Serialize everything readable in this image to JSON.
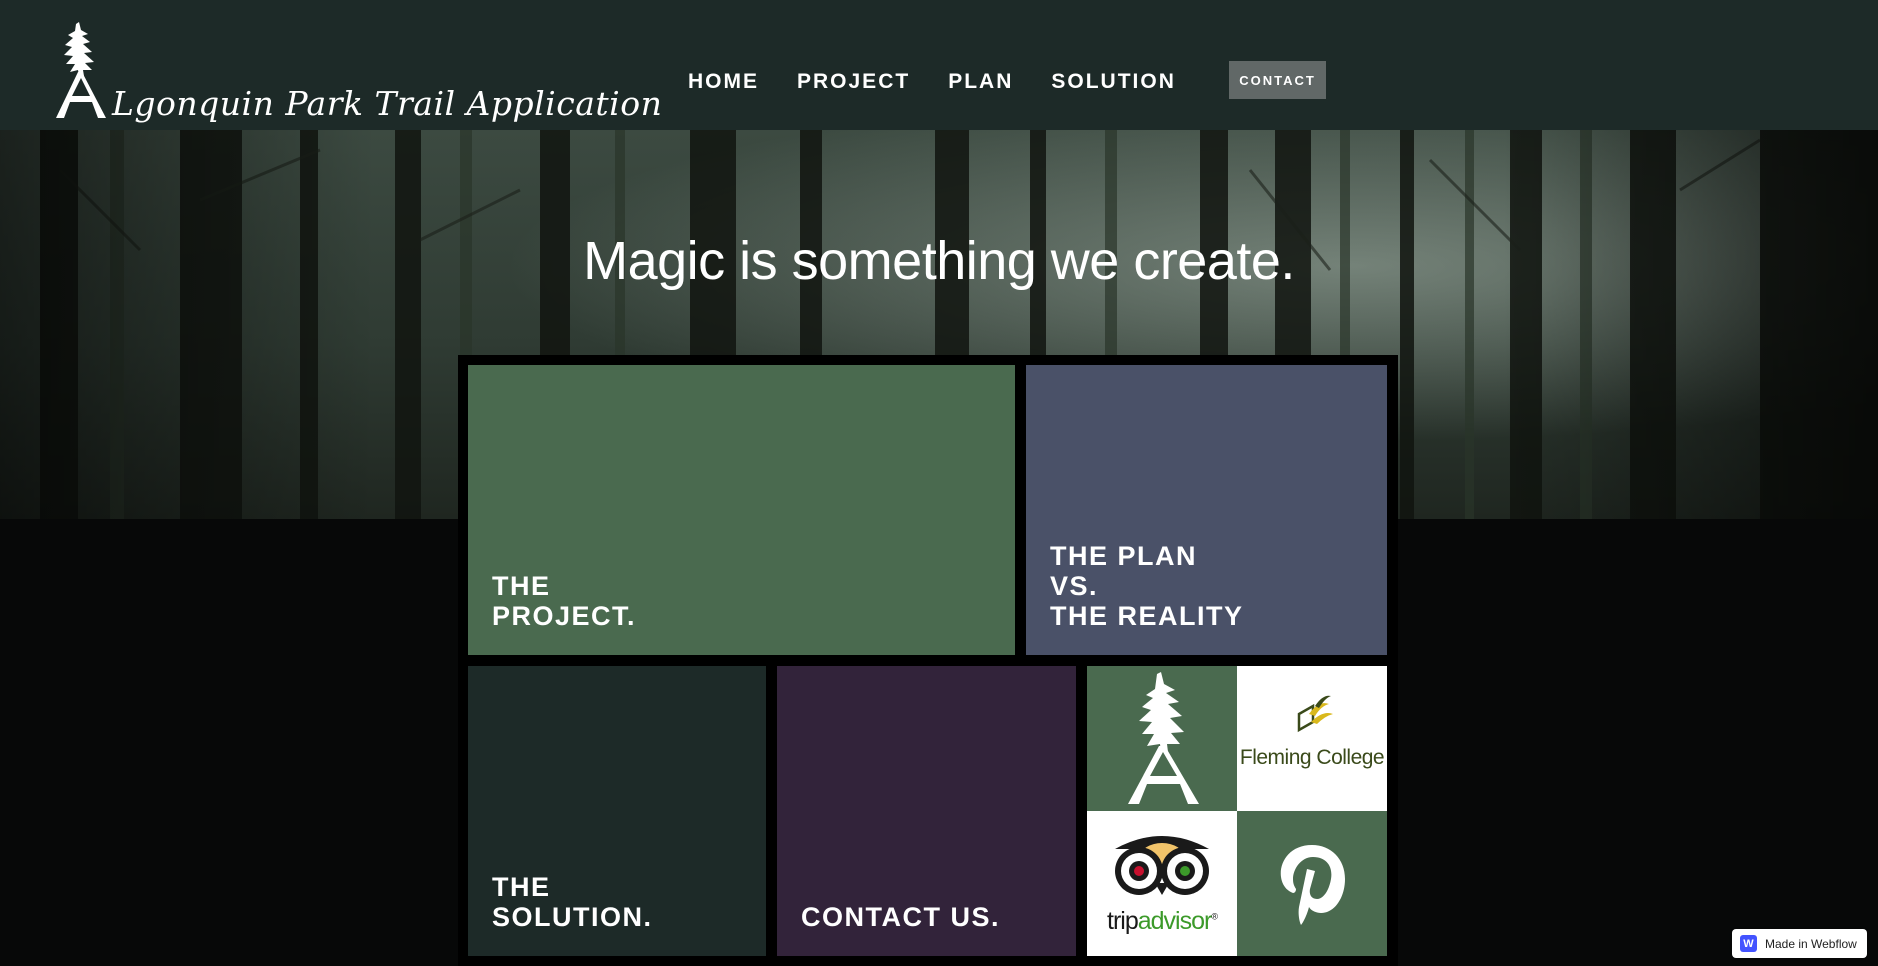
{
  "header": {
    "logo_text": "Lgonquin Park Trail Application",
    "nav": [
      {
        "label": "HOME"
      },
      {
        "label": "PROJECT"
      },
      {
        "label": "PLAN"
      },
      {
        "label": "SOLUTION"
      }
    ],
    "contact_label": "CONTACT"
  },
  "hero": {
    "title": "Magic is something we create."
  },
  "tiles": {
    "project": {
      "line1": "THE",
      "line2": "PROJECT."
    },
    "plan": {
      "line1": "THE PLAN",
      "line2": "VS.",
      "line3": "THE REALITY"
    },
    "solution": {
      "line1": "THE",
      "line2": "SOLUTION."
    },
    "contact": {
      "line1": "CONTACT US."
    }
  },
  "partner_logos": {
    "algonquin": {
      "icon": "algonquin-tree-logo"
    },
    "fleming": {
      "label": "Fleming College"
    },
    "tripadvisor": {
      "label_a": "trip",
      "label_b": "advisor",
      "mark": "®"
    },
    "pinterest": {
      "icon": "pinterest-p-logo"
    }
  },
  "badge": {
    "icon_letter": "W",
    "label": "Made in Webflow"
  },
  "colors": {
    "header_bg": "#1d2a28",
    "project_tile": "#4a6a4f",
    "plan_tile": "#4a5168",
    "solution_tile": "#1d2a28",
    "contact_tile": "#32233a",
    "contact_button": "#616867"
  }
}
